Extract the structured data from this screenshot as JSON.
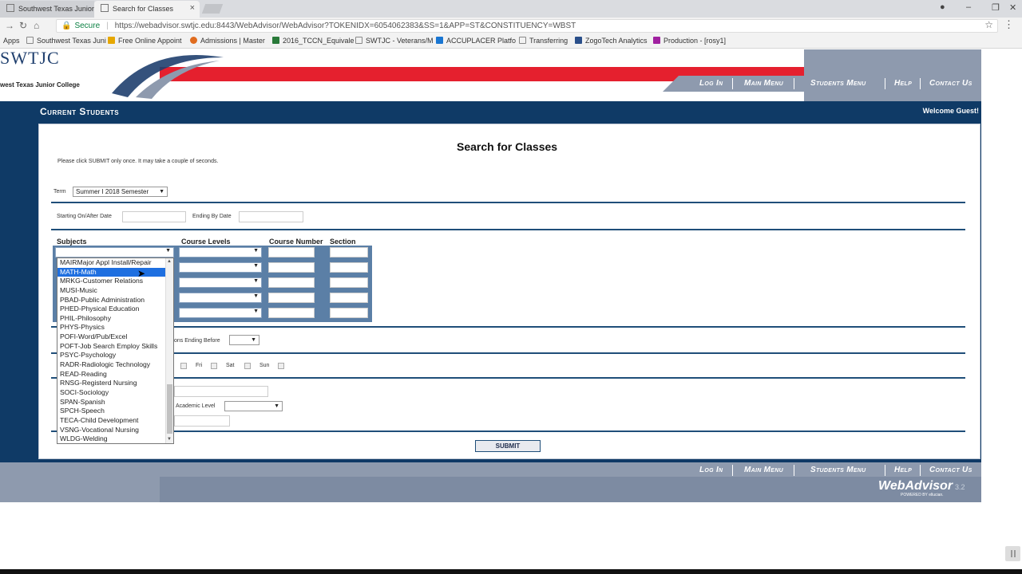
{
  "browser": {
    "tabs": [
      {
        "label": "Southwest Texas Junior C"
      },
      {
        "label": "Search for Classes"
      }
    ],
    "secure_label": "Secure",
    "url": "https://webadvisor.swtjc.edu:8443/WebAdvisor/WebAdvisor?TOKENIDX=6054062383&SS=1&APP=ST&CONSTITUENCY=WBST",
    "bookmarks": [
      {
        "label": "Apps",
        "color": "#4a7bd0"
      },
      {
        "label": "Southwest Texas Juni",
        "color": "#888888"
      },
      {
        "label": "Free Online Appoint",
        "color": "#e6a700"
      },
      {
        "label": "Admissions | Master",
        "color": "#e06c1f"
      },
      {
        "label": "2016_TCCN_Equivale",
        "color": "#2a7a3a"
      },
      {
        "label": "SWTJC - Veterans/M",
        "color": "#888888"
      },
      {
        "label": "ACCUPLACER Platfo",
        "color": "#1976d2"
      },
      {
        "label": "Transferring",
        "color": "#888888"
      },
      {
        "label": "ZogoTech Analytics",
        "color": "#2a4f8a"
      },
      {
        "label": "Production - [rosy1]",
        "color": "#a020a0"
      }
    ]
  },
  "site": {
    "logo_text": "SWTJC",
    "logo_sub": "west Texas Junior College",
    "nav": [
      "Log In",
      "Main Menu",
      "Students Menu",
      "Help",
      "Contact Us"
    ],
    "section_title": "Current Students",
    "welcome": "Welcome Guest!"
  },
  "form": {
    "heading": "Search for Classes",
    "instructions": "Please click SUBMIT only once. It may take a couple of seconds.",
    "term_label": "Term",
    "term_value": "Summer I 2018 Semester",
    "start_date_label": "Starting On/After Date",
    "end_date_label": "Ending By Date",
    "col_subjects": "Subjects",
    "col_levels": "Course Levels",
    "col_number": "Course Number",
    "col_section": "Section",
    "sections_ending_label": "ons Ending Before",
    "days": [
      "Fri",
      "Sat",
      "Sun"
    ],
    "academic_level_label": "Academic Level",
    "submit_label": "SUBMIT"
  },
  "subject_dropdown": {
    "highlighted_index": 1,
    "options": [
      "MAIRMajor Appl Install/Repair",
      "MATH-Math",
      "MRKG-Customer Relations",
      "MUSI-Music",
      "PBAD-Public Administration",
      "PHED-Physical Education",
      "PHIL-Philosophy",
      "PHYS-Physics",
      "POFI-Word/Pub/Excel",
      "POFT-Job Search Employ Skills",
      "PSYC-Psychology",
      "RADR-Radiologic Technology",
      "READ-Reading",
      "RNSG-Registerd Nursing",
      "SOCI-Sociology",
      "SPAN-Spanish",
      "SPCH-Speech",
      "TECA-Child Development",
      "VSNG-Vocational Nursing",
      "WLDG-Welding"
    ]
  },
  "footer": {
    "nav": [
      "Log In",
      "Main Menu",
      "Students Menu",
      "Help",
      "Contact Us"
    ],
    "brand": "WebAdvisor",
    "version": "3.2",
    "powered": "POWERED BY ellucian."
  }
}
